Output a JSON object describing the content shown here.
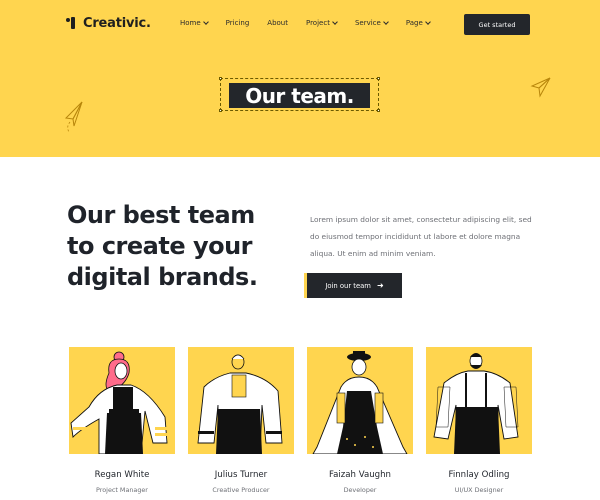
{
  "brand": {
    "name": "Creativic."
  },
  "nav": {
    "items": [
      {
        "label": "Home",
        "has_dropdown": true
      },
      {
        "label": "Pricing",
        "has_dropdown": false
      },
      {
        "label": "About",
        "has_dropdown": false
      },
      {
        "label": "Project",
        "has_dropdown": true
      },
      {
        "label": "Service",
        "has_dropdown": true
      },
      {
        "label": "Page",
        "has_dropdown": true
      }
    ],
    "cta_label": "Get started"
  },
  "hero": {
    "title": "Our team."
  },
  "intro": {
    "heading_lines": [
      "Our best team",
      "to create your",
      "digital brands."
    ],
    "paragraph": "Lorem ipsum dolor sit amet, consectetur adipiscing elit, sed do eiusmod tempor incididunt ut labore et dolore magna aliqua. Ut enim ad minim veniam.",
    "button_label": "Join our team",
    "button_icon": "arrow-right-icon"
  },
  "team": [
    {
      "name": "Regan White",
      "role": "Project Manager"
    },
    {
      "name": "Julius Turner",
      "role": "Creative Producer"
    },
    {
      "name": "Faizah Vaughn",
      "role": "Developer"
    },
    {
      "name": "Finnlay Odling",
      "role": "UI/UX Designer"
    }
  ],
  "colors": {
    "accent": "#ffd54f",
    "dark": "#23262b",
    "muted": "#6d6f75",
    "white": "#ffffff"
  }
}
